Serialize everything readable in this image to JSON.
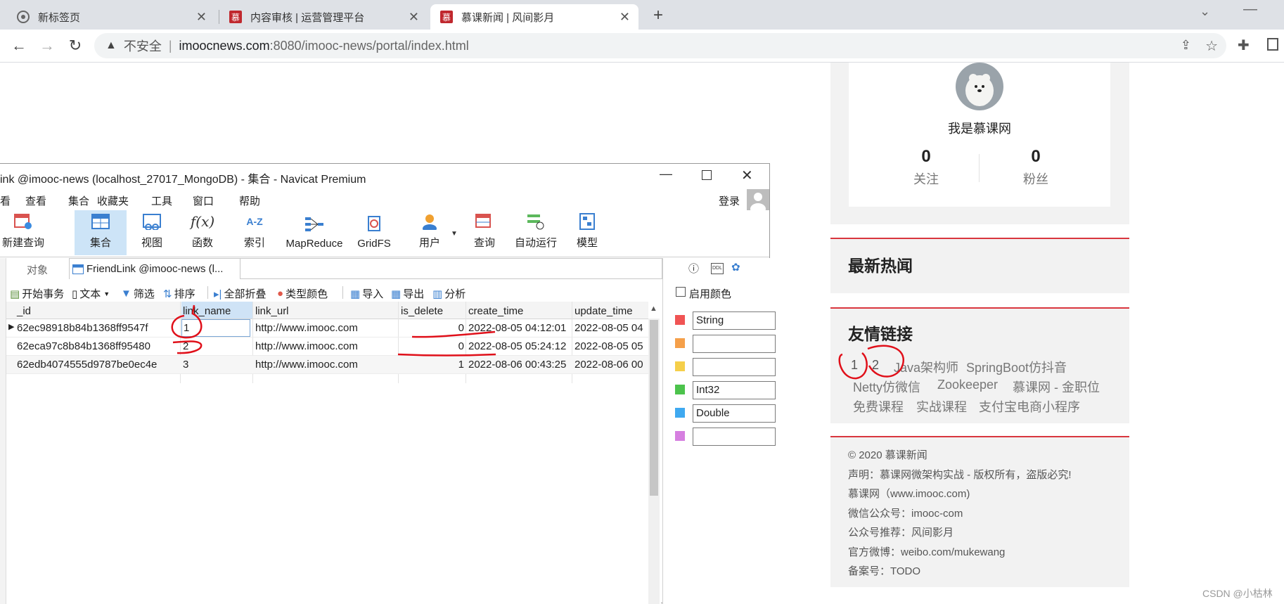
{
  "browser": {
    "tabs": [
      {
        "title": "新标签页",
        "active": false
      },
      {
        "title": "内容审核 | 运营管理平台",
        "active": false
      },
      {
        "title": "慕课新闻 | 风间影月",
        "active": true
      }
    ],
    "address": {
      "security_label": "不安全",
      "host": "imoocnews.com",
      "path": ":8080/imooc-news/portal/index.html"
    }
  },
  "portal": {
    "profile": {
      "name": "我是慕课网",
      "follow_count": "0",
      "follow_label": "关注",
      "fans_count": "0",
      "fans_label": "粉丝"
    },
    "hot_news": {
      "title": "最新热闻"
    },
    "friend_links": {
      "title": "友情链接",
      "links": [
        "1",
        "2",
        "Java架构师",
        "SpringBoot仿抖音",
        "Netty仿微信",
        "Zookeeper",
        "慕课网 - 金职位",
        "免费课程",
        "实战课程",
        "支付宝电商小程序"
      ]
    },
    "footer": {
      "lines": [
        "© 2020 慕课新闻",
        "声明：慕课网微架构实战 - 版权所有，盗版必究!",
        "慕课网（www.imooc.com)",
        "微信公众号：imooc-com",
        "公众号推荐：风间影月",
        "官方微博：weibo.com/mukewang",
        "备案号：TODO"
      ]
    },
    "watermark": "CSDN @小枯林"
  },
  "navicat": {
    "title": "ink @imooc-news (localhost_27017_MongoDB) - 集合 - Navicat Premium",
    "menu": [
      "看",
      "查看",
      "集合",
      "收藏夹",
      "工具",
      "窗口",
      "帮助"
    ],
    "login": "登录",
    "toolbar": [
      "新建查询",
      "集合",
      "视图",
      "函数",
      "索引",
      "MapReduce",
      "GridFS",
      "用户",
      "查询",
      "自动运行",
      "模型"
    ],
    "tabs": {
      "objects": "对象",
      "active": "FriendLink @imooc-news (l..."
    },
    "actions": [
      "开始事务",
      "文本",
      "筛选",
      "排序",
      "全部折叠",
      "类型颜色",
      "导入",
      "导出",
      "分析"
    ],
    "columns": [
      "_id",
      "link_name",
      "link_url",
      "is_delete",
      "create_time",
      "update_time"
    ],
    "rows": [
      [
        "62ec98918b84b1368ff9547f",
        "1",
        "http://www.imooc.com",
        "0",
        "2022-08-05 04:12:01",
        "2022-08-05 04"
      ],
      [
        "62eca97c8b84b1368ff95480",
        "2",
        "http://www.imooc.com",
        "0",
        "2022-08-05 05:24:12",
        "2022-08-05 05"
      ],
      [
        "62edb4074555d9787be0ec4e",
        "3",
        "http://www.imooc.com",
        "1",
        "2022-08-06 00:43:25",
        "2022-08-06 00"
      ]
    ],
    "side_panel": {
      "enable_color": "启用颜色",
      "types": [
        {
          "color": "#f05454",
          "label": "String"
        },
        {
          "color": "#f5a04a",
          "label": ""
        },
        {
          "color": "#f5cf4a",
          "label": ""
        },
        {
          "color": "#4cc34c",
          "label": "Int32"
        },
        {
          "color": "#3fa9f0",
          "label": "Double"
        },
        {
          "color": "#d67fe0",
          "label": ""
        }
      ]
    }
  }
}
